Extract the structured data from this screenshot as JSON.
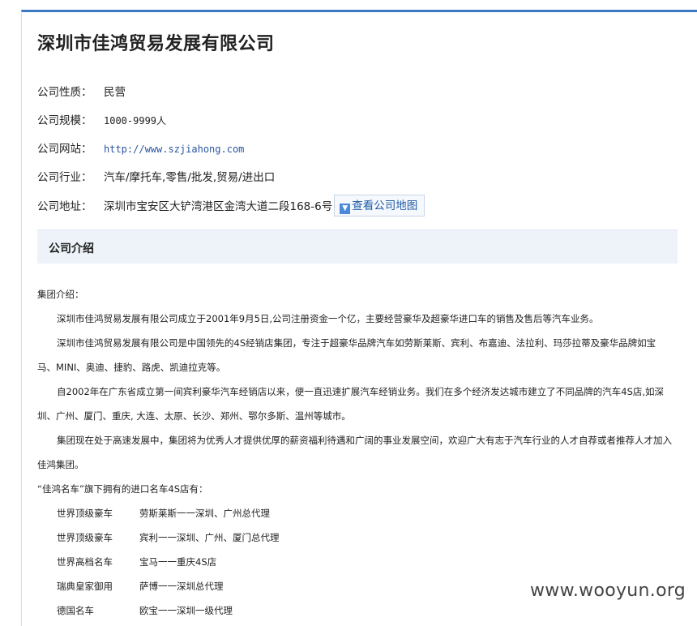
{
  "company": {
    "name": "深圳市佳鸿贸易发展有限公司",
    "fields": [
      {
        "label": "公司性质：",
        "value": "民营"
      },
      {
        "label": "公司规模：",
        "value": "1000-9999人"
      },
      {
        "label": "公司网站：",
        "value": "http://www.szjiahong.com"
      },
      {
        "label": "公司行业：",
        "value": "汽车/摩托车,零售/批发,贸易/进出口"
      },
      {
        "label": "公司地址：",
        "value": "深圳市宝安区大铲湾港区金湾大道二段168-6号"
      }
    ],
    "map_button": "查看公司地图"
  },
  "section": {
    "title": "公司介绍"
  },
  "intro": {
    "heading": "集团介绍：",
    "paragraphs": [
      "深圳市佳鸿贸易发展有限公司成立于2001年9月5日,公司注册资金一个亿，主要经营豪华及超豪华进口车的销售及售后等汽车业务。",
      "深圳市佳鸿贸易发展有限公司是中国领先的4S经销店集团，专注于超豪华品牌汽车如劳斯莱斯、宾利、布嘉迪、法拉利、玛莎拉蒂及豪华品牌如宝马、MINI、奥迪、捷豹、路虎、凯迪拉克等。",
      "自2002年在广东省成立第一间宾利豪华汽车经销店以来，便一直迅速扩展汽车经销业务。我们在多个经济发达城市建立了不同品牌的汽车4S店,如深圳、广州、厦门、重庆, 大连、太原、长沙、郑州、鄂尔多斯、温州等城市。",
      "集团现在处于高速发展中，集团将为优秀人才提供优厚的薪资福利待遇和广阔的事业发展空间，欢迎广大有志于汽车行业的人才自荐或者推荐人才加入佳鸿集团。"
    ],
    "brands_heading": "“佳鸿名车”旗下拥有的进口名车4S店有：",
    "brands": [
      {
        "category": "世界顶级豪车",
        "detail": "劳斯莱斯一一深圳、广州总代理"
      },
      {
        "category": "世界顶级豪车",
        "detail": "宾利一一深圳、广州、厦门总代理"
      },
      {
        "category": "世界高档名车",
        "detail": "宝马一一重庆4S店"
      },
      {
        "category": "瑞典皇家御用",
        "detail": "萨博一一深圳总代理"
      },
      {
        "category": "德国名车",
        "detail": "欧宝一一深圳一级代理"
      }
    ]
  },
  "watermark": "www.wooyun.org",
  "colors": {
    "accent": "#3b79c3",
    "link": "#2b55a0",
    "section_bg": "#eef3f9"
  }
}
